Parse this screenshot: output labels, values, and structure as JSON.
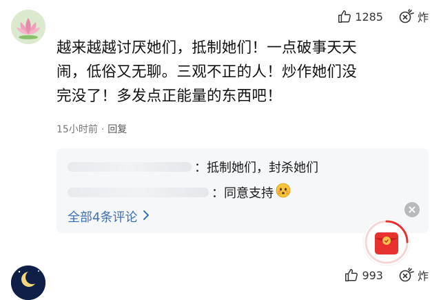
{
  "comment": {
    "likes": "1285",
    "explode_label": "炸",
    "text_lines": [
      "越来越越讨厌她们，抵制她们！一点破事天天",
      "闹，低俗又无聊。三观不正的人！炒作她们没",
      "完没了！多发点正能量的东西吧！"
    ],
    "time": "15小时前",
    "separator": "·",
    "reply_label": "回复"
  },
  "replies": {
    "items": [
      {
        "text": "：抵制她们，封杀她们"
      },
      {
        "text": "：同意支持"
      }
    ],
    "view_all_label": "全部4条评论"
  },
  "next_comment": {
    "likes": "993",
    "explode_label": "炸"
  },
  "colors": {
    "link_blue": "#3f6fb4",
    "reply_bg": "#f6f7f9",
    "red_packet": "#e8322f"
  },
  "icons": {
    "like": "thumbs-up-icon",
    "explode": "firecracker-icon",
    "close": "close-icon",
    "chevron": "chevron-right-icon",
    "red_packet": "red-packet-icon",
    "emoji": "shy-face-emoji-icon"
  }
}
